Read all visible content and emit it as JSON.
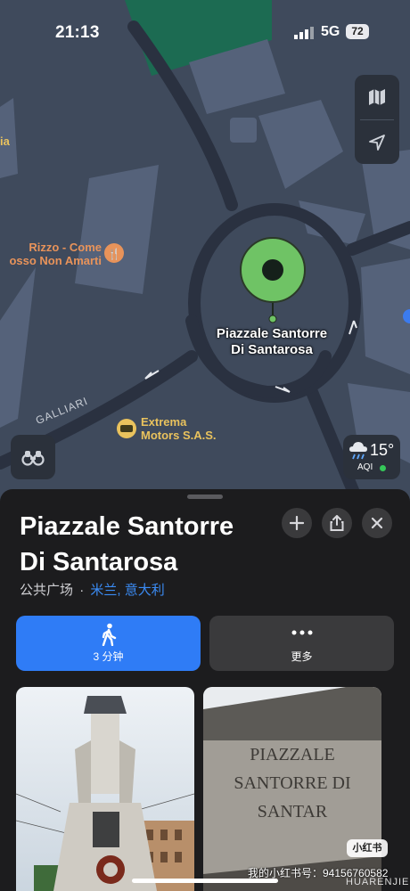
{
  "status": {
    "time": "21:13",
    "network": "5G",
    "battery": "72"
  },
  "map": {
    "pin_label": "Piazzale Santorre Di Santarosa",
    "poi_rizzo": "Rizzo - Come\nosso Non Amarti",
    "poi_extrema": "Extrema\nMotors S.A.S.",
    "poi_left": "ia",
    "street": "GALLIARI",
    "weather": {
      "temp": "15°",
      "aqi": "AQI"
    }
  },
  "sheet": {
    "title": "Piazzale Santorre Di Santarosa",
    "category": "公共广场",
    "separator": "·",
    "location": "米兰, 意大利",
    "walk_label": "3 分钟",
    "more_label": "更多",
    "photo2_text": "PIAZZALE\nSANTORRE DI SANTAR"
  },
  "watermark": {
    "line1": "我的小红书号：94156760582",
    "line2": "HUARENJIE",
    "badge": "小红书"
  },
  "colors": {
    "accent": "#2f7cf6",
    "pin": "#6fc365",
    "sheet": "#1c1c1e",
    "map_bg": "#3f4a5c"
  }
}
